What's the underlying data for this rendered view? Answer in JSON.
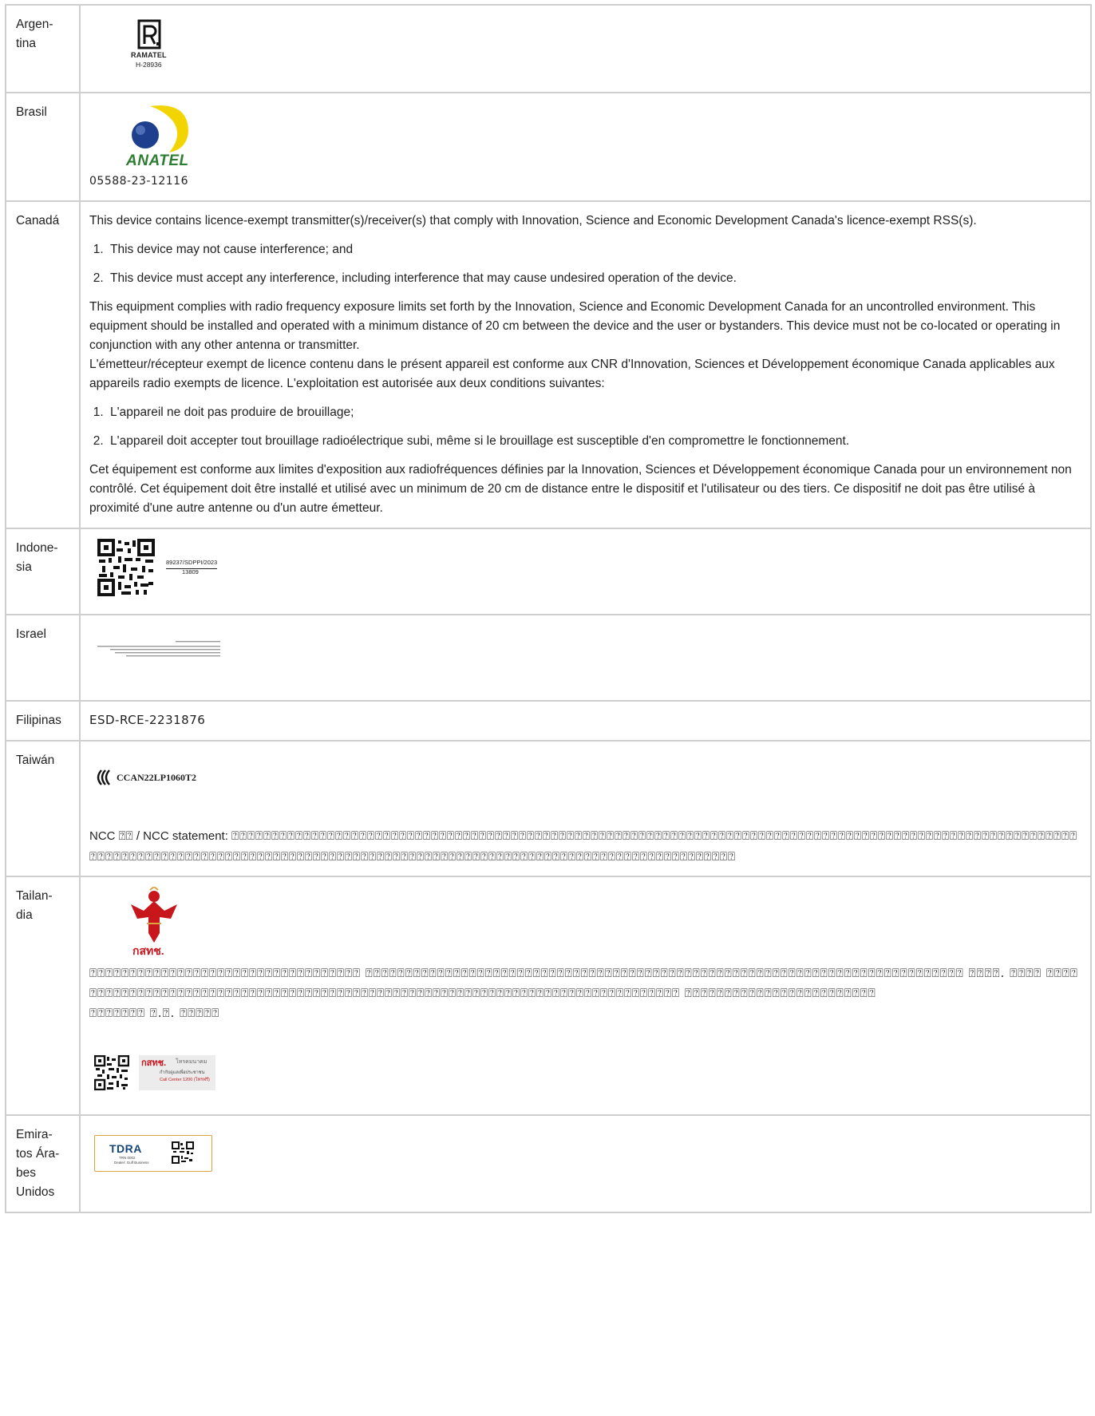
{
  "rows": [
    {
      "country": "Argen-\ntina",
      "ramatel_label": "RAMATEL",
      "ramatel_code": "H-28936"
    },
    {
      "country": "Brasil",
      "anatel_label": "ANATEL",
      "anatel_code": "05588-23-12116"
    },
    {
      "country": "Canadá",
      "intro_en": "This device contains licence-exempt transmitter(s)/receiver(s) that comply with Innovation, Science and Economic Development Canada's licence-exempt RSS(s).",
      "list_en": [
        "This device may not cause interference; and",
        "This device must accept any interference, including interference that may cause undesired operation of the device."
      ],
      "exposure_en": "This equipment complies with radio frequency exposure limits set forth by the Innovation, Science and Economic Development Canada for an uncontrolled environment. This equipment should be installed and operated with a minimum distance of 20 cm between the device and the user or bystanders. This device must not be co-located or operating in conjunction with any other antenna or transmitter.",
      "intro_fr": "L'émetteur/récepteur exempt de licence contenu dans le présent appareil est conforme aux CNR d'Innovation, Sciences et Développement économique Ca­nada applicables aux appareils radio exempts de licence. L'exploitation est autorisée aux deux conditions suivantes:",
      "list_fr": [
        "L'appareil ne doit pas produire de brouillage;",
        "L'appareil doit accepter tout brouillage radioélectrique subi, même si le brouillage est susceptible d'en compromettre le fonctionnement."
      ],
      "exposure_fr": "Cet équipement est conforme aux limites d'exposition aux radiofréquences définies par la Innovation, Sciences et Développement économique Canada pour un environnement non contrôlé. Cet équipement doit être installé et utilisé avec un minimum de 20 cm de distance entre le dispositif et l'utilisateur ou des tiers. Ce dispositif ne doit pas être utilisé à proximité d'une autre antenne ou d'un autre émetteur."
    },
    {
      "country": "Indone-\nsia",
      "cert_top": "89237/SDPPI/2023",
      "cert_bottom": "13809"
    },
    {
      "country": "Israel"
    },
    {
      "country": "Filipinas",
      "code": "ESD-RCE-2231876"
    },
    {
      "country": "Taiwán",
      "ncc_code": "CCAN22LP1060T2",
      "ncc_statement_prefix": "NCC ⍰⍰ / NCC statement: ",
      "ncc_statement_glyphs": "⍰⍰⍰⍰⍰⍰⍰⍰⍰⍰⍰⍰⍰⍰⍰⍰⍰⍰⍰⍰⍰⍰⍰⍰⍰⍰⍰⍰⍰⍰⍰⍰⍰⍰⍰⍰⍰⍰⍰⍰⍰⍰⍰⍰⍰⍰⍰⍰⍰⍰⍰⍰⍰⍰⍰⍰⍰⍰⍰⍰⍰⍰⍰⍰⍰⍰⍰⍰⍰⍰⍰⍰⍰⍰⍰⍰⍰⍰⍰⍰⍰⍰⍰⍰⍰⍰⍰⍰⍰⍰⍰⍰⍰⍰⍰⍰⍰⍰⍰⍰⍰⍰⍰⍰⍰⍰⍰⍰⍰⍰⍰⍰⍰⍰⍰⍰⍰⍰⍰⍰⍰⍰⍰⍰⍰⍰⍰⍰⍰⍰⍰⍰⍰⍰⍰⍰⍰⍰⍰⍰⍰⍰⍰⍰⍰⍰⍰⍰⍰⍰⍰⍰⍰⍰⍰⍰⍰⍰⍰⍰⍰⍰⍰⍰⍰⍰⍰⍰⍰⍰⍰⍰⍰⍰⍰⍰⍰⍰⍰⍰⍰⍰⍰⍰⍰⍰⍰"
    },
    {
      "country": "Tailan-\ndia",
      "nbtc_label": "กสทช.",
      "thai_text_1": "⍰⍰⍰⍰⍰⍰⍰⍰⍰⍰⍰⍰⍰⍰⍰⍰⍰⍰⍰⍰⍰⍰⍰⍰⍰⍰⍰⍰⍰⍰⍰⍰⍰⍰ ⍰⍰⍰⍰⍰⍰⍰⍰⍰⍰⍰⍰⍰⍰⍰⍰⍰⍰⍰⍰⍰⍰⍰⍰⍰⍰⍰⍰⍰⍰⍰⍰⍰⍰⍰⍰⍰⍰⍰⍰⍰⍰⍰⍰⍰⍰⍰⍰⍰⍰⍰⍰⍰⍰⍰⍰⍰⍰⍰⍰⍰⍰⍰⍰⍰⍰⍰⍰⍰⍰⍰⍰⍰⍰⍰ ⍰⍰⍰⍰. ⍰⍰⍰⍰ ⍰⍰⍰⍰⍰⍰⍰⍰⍰⍰⍰⍰⍰⍰⍰⍰⍰⍰⍰⍰⍰⍰⍰⍰⍰⍰⍰⍰⍰⍰⍰⍰⍰⍰⍰⍰⍰⍰⍰⍰⍰⍰⍰⍰⍰⍰⍰⍰⍰⍰⍰⍰⍰⍰⍰⍰⍰⍰⍰⍰⍰⍰⍰⍰⍰⍰⍰⍰⍰⍰⍰⍰⍰⍰⍰⍰⍰⍰ ⍰⍰⍰⍰⍰⍰⍰⍰⍰⍰⍰⍰⍰⍰⍰⍰⍰⍰⍰⍰⍰⍰⍰⍰",
      "thai_text_2": "⍰⍰⍰⍰⍰⍰⍰ ⍰.⍰. ⍰⍰⍰⍰⍰",
      "badge_brand": "กสทช.",
      "badge_org": "โทรคมนาคม",
      "badge_line1": "กำกับดูแลเพื่อประชาชน",
      "badge_line2": "Call Center 1200 (โทรฟรี)"
    },
    {
      "country": "Emira-\ntos Ára-\nbes\nUnidos",
      "tdra_label": "TDRA",
      "tdra_sub1": "TRN 0002",
      "tdra_sub2": "Dealer: Gulf Business"
    }
  ],
  "colors": {
    "border": "#cfcfcf",
    "anatel_yellow": "#f2d500",
    "anatel_blue": "#1d3f8e",
    "anatel_green": "#2e7d32",
    "garuda_red": "#c8161d",
    "nbtc_red": "#c8161d",
    "tdra_blue": "#16457a",
    "tdra_border": "#d9a441"
  }
}
